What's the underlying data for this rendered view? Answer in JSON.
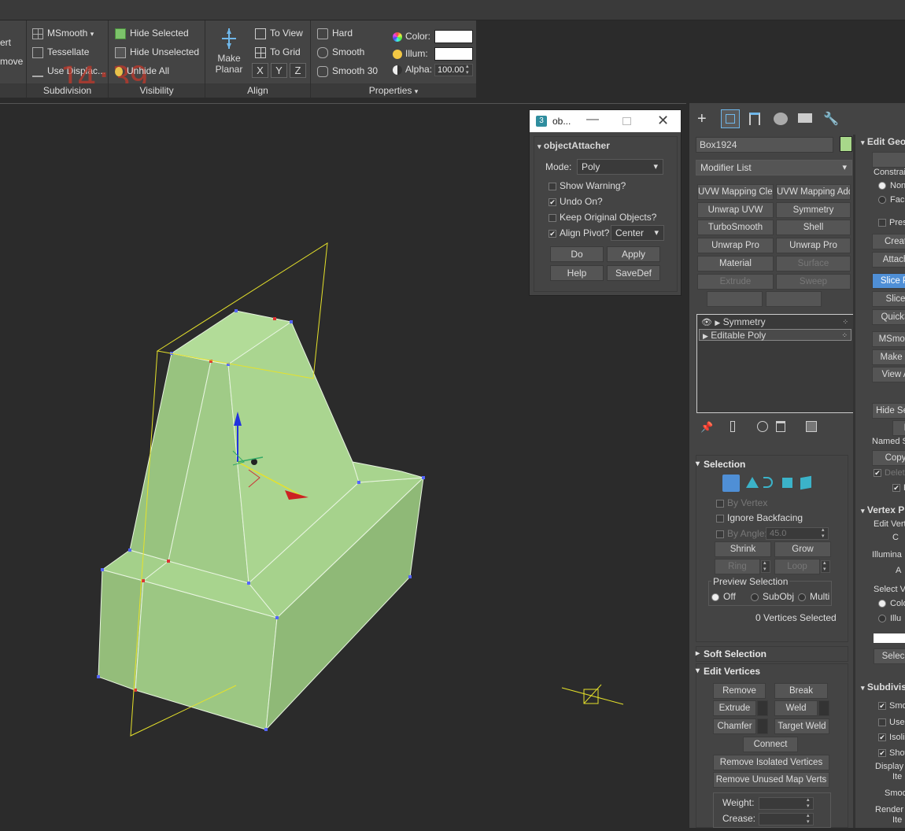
{
  "ribbon": {
    "left_partial": {
      "line1": "ert",
      "line2": "move"
    },
    "clock": "14:39",
    "subdivision": {
      "items": [
        "MSmooth",
        "Tessellate",
        "Use Displac..."
      ],
      "footer": "Subdivision"
    },
    "visibility": {
      "items": [
        "Hide Selected",
        "Hide Unselected",
        "Unhide All"
      ],
      "footer": "Visibility"
    },
    "align": {
      "make_planar": "Make",
      "make_planar2": "Planar",
      "to_view": "To View",
      "to_grid": "To Grid",
      "x": "X",
      "y": "Y",
      "z": "Z",
      "footer": "Align"
    },
    "smoothing": {
      "items": [
        "Hard",
        "Smooth",
        "Smooth 30"
      ]
    },
    "properties": {
      "color_label": "Color:",
      "illum_label": "Illum:",
      "alpha_label": "Alpha:",
      "alpha_value": "100.00",
      "footer": "Properties"
    }
  },
  "dialog": {
    "title": "ob...",
    "rollout": "objectAttacher",
    "mode_label": "Mode:",
    "mode_value": "Poly",
    "show_warning": "Show Warning?",
    "undo_on": "Undo On?",
    "keep_original": "Keep Original Objects?",
    "align_pivot": "Align Pivot?",
    "pivot_value": "Center",
    "do": "Do",
    "apply": "Apply",
    "help": "Help",
    "savedef": "SaveDef"
  },
  "panel": {
    "object_name": "Box1924",
    "object_color": "#a8d88a",
    "modifier_list": "Modifier List",
    "mod_buttons": [
      "UVW Mapping Clear",
      "UVW Mapping Add",
      "Unwrap UVW",
      "Symmetry",
      "TurboSmooth",
      "Shell",
      "Unwrap Pro",
      "Unwrap Pro",
      "Material",
      "Surface",
      "Extrude",
      "Sweep"
    ],
    "stack": [
      "Symmetry",
      "Editable Poly"
    ],
    "selection": {
      "title": "Selection",
      "by_vertex": "By Vertex",
      "ignore_backfacing": "Ignore Backfacing",
      "by_angle": "By Angle:",
      "angle_value": "45.0",
      "shrink": "Shrink",
      "grow": "Grow",
      "ring": "Ring",
      "loop": "Loop",
      "preview": "Preview Selection",
      "off": "Off",
      "subobj": "SubObj",
      "multi": "Multi",
      "status": "0 Vertices Selected"
    },
    "soft_selection": "Soft Selection",
    "edit_vertices": {
      "title": "Edit Vertices",
      "remove": "Remove",
      "break": "Break",
      "extrude": "Extrude",
      "weld": "Weld",
      "chamfer": "Chamfer",
      "target_weld": "Target Weld",
      "connect": "Connect",
      "remove_isolated": "Remove Isolated Vertices",
      "remove_unused": "Remove Unused Map Verts",
      "weight": "Weight:",
      "crease": "Crease:"
    },
    "right_col": [
      "Edit Geo",
      "Constrai",
      "Non",
      "Fac",
      "Pres",
      "Creat",
      "Attach",
      "Slice Pl",
      "Slice",
      "QuickS",
      "MSmoot",
      "Make P",
      "View A",
      "Hide Sele",
      "Hi",
      "Named S",
      "Copy",
      "Delete",
      "F",
      "Vertex P",
      "Edit Vert",
      "C",
      "Illumina",
      "A",
      "Select V",
      "Colo",
      "Illu",
      "Selec",
      "Subdivis",
      "Smoo",
      "Use N",
      "Isolin",
      "Show",
      "Display",
      "Ite",
      "Smoo",
      "Render",
      "Ite"
    ]
  },
  "colors": {
    "accent": "#4f8fd6",
    "mesh": "#a8d88a",
    "gizmo": "#e6e22b"
  }
}
